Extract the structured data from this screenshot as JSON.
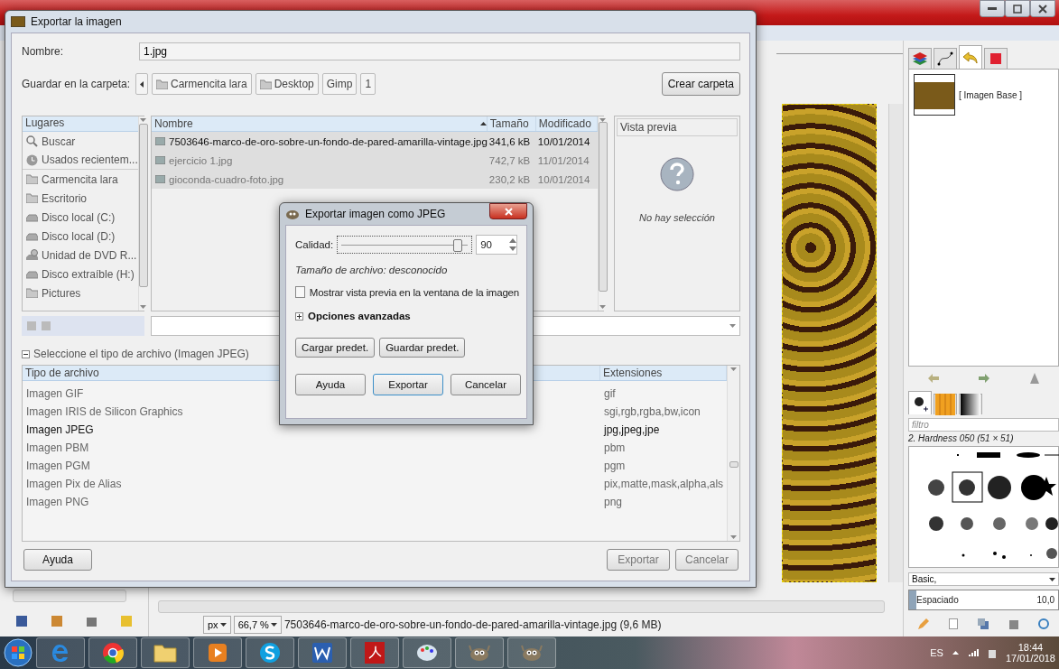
{
  "gimp": {
    "dock_tabs": [
      {
        "kind": "layers",
        "selected": false
      },
      {
        "kind": "paths",
        "selected": false
      },
      {
        "kind": "undo",
        "selected": true
      },
      {
        "kind": "channels",
        "selected": false
      }
    ],
    "layers": [
      {
        "name": "[ Imagen Base ]"
      }
    ],
    "brush_tabs": [
      {
        "kind": "brushes",
        "selected": true
      },
      {
        "kind": "patterns",
        "selected": false
      },
      {
        "kind": "gradients",
        "selected": false
      }
    ],
    "brush_filter": {
      "placeholder": "filtro"
    },
    "brush_name": "2. Hardness 050 (51 × 51)",
    "brush_tag": "Basic,",
    "spacing": {
      "label": "Espaciado",
      "reading": "10,0",
      "level": 0.05
    },
    "unit": "px",
    "zoom": "66,7 %",
    "status": "7503646-marco-de-oro-sobre-un-fondo-de-pared-amarilla-vintage.jpg (9,6 MB)"
  },
  "export_dialog": {
    "title": "Exportar la imagen",
    "name_label": "Nombre:",
    "name_value": "1.jpg",
    "folder_label": "Guardar en la carpeta:",
    "path": [
      {
        "label": "Carmencita lara",
        "folder": true
      },
      {
        "label": "Desktop",
        "folder": true
      },
      {
        "label": "Gimp",
        "folder": false
      },
      {
        "label": "1",
        "folder": false
      }
    ],
    "create_folder": "Crear carpeta",
    "places": {
      "header": "Lugares",
      "items": [
        {
          "label": "Buscar",
          "kind": "search"
        },
        {
          "label": "Usados recientem...",
          "kind": "recent"
        },
        {
          "label": "Carmencita lara",
          "kind": "folder"
        },
        {
          "label": "Escritorio",
          "kind": "folder"
        },
        {
          "label": "Disco local (C:)",
          "kind": "disk"
        },
        {
          "label": "Disco local (D:)",
          "kind": "disk"
        },
        {
          "label": "Unidad de DVD R...",
          "kind": "dvd"
        },
        {
          "label": "Disco extraíble (H:)",
          "kind": "disk"
        },
        {
          "label": "Pictures",
          "kind": "folder"
        }
      ]
    },
    "files": {
      "columns": [
        "Nombre",
        "Tamaño",
        "Modificado"
      ],
      "rows": [
        {
          "name": "7503646-marco-de-oro-sobre-un-fondo-de-pared-amarilla-vintage.jpg",
          "size": "341,6 kB",
          "modified": "10/01/2014",
          "selected": true
        },
        {
          "name": "ejercicio 1.jpg",
          "size": "742,7 kB",
          "modified": "11/01/2014",
          "selected": false
        },
        {
          "name": "gioconda-cuadro-foto.jpg",
          "size": "230,2 kB",
          "modified": "10/01/2014",
          "selected": false
        }
      ]
    },
    "preview": {
      "title": "Vista previa",
      "empty": "No hay selección"
    },
    "file_type": {
      "label": "Seleccione el tipo de archivo (Imagen JPEG)",
      "expanded": true,
      "columns": [
        "Tipo de archivo",
        "Extensiones"
      ],
      "rows": [
        {
          "type": "Imagen GIF",
          "ext": "gif",
          "selected": false
        },
        {
          "type": "Imagen IRIS de Silicon Graphics",
          "ext": "sgi,rgb,rgba,bw,icon",
          "selected": false
        },
        {
          "type": "Imagen JPEG",
          "ext": "jpg,jpeg,jpe",
          "selected": true
        },
        {
          "type": "Imagen PBM",
          "ext": "pbm",
          "selected": false
        },
        {
          "type": "Imagen PGM",
          "ext": "pgm",
          "selected": false
        },
        {
          "type": "Imagen Pix de Alias",
          "ext": "pix,matte,mask,alpha,als",
          "selected": false
        },
        {
          "type": "Imagen PNG",
          "ext": "png",
          "selected": false
        }
      ]
    },
    "help": "Ayuda",
    "export": "Exportar",
    "cancel": "Cancelar"
  },
  "jpeg_dialog": {
    "title": "Exportar imagen como JPEG",
    "quality": {
      "label": "Calidad:",
      "level": 0.9,
      "value": "90"
    },
    "file_size": "Tamaño de archivo: desconocido",
    "preview": {
      "label": "Mostrar vista previa en la ventana de la imagen",
      "checked": false
    },
    "advanced": {
      "label": "Opciones avanzadas",
      "expanded": false
    },
    "presets": [
      "Cargar predet.",
      "Guardar predet."
    ],
    "buttons": [
      "Ayuda",
      "Exportar",
      "Cancelar"
    ]
  },
  "taskbar": {
    "apps": [
      {
        "kind": "ie"
      },
      {
        "kind": "chrome"
      },
      {
        "kind": "explorer"
      },
      {
        "kind": "media"
      },
      {
        "kind": "skype"
      },
      {
        "kind": "word"
      },
      {
        "kind": "pdf"
      },
      {
        "kind": "paint"
      },
      {
        "kind": "gimp"
      },
      {
        "kind": "gimp"
      }
    ],
    "language": "ES",
    "time": "18:44",
    "date": "17/01/2018"
  }
}
